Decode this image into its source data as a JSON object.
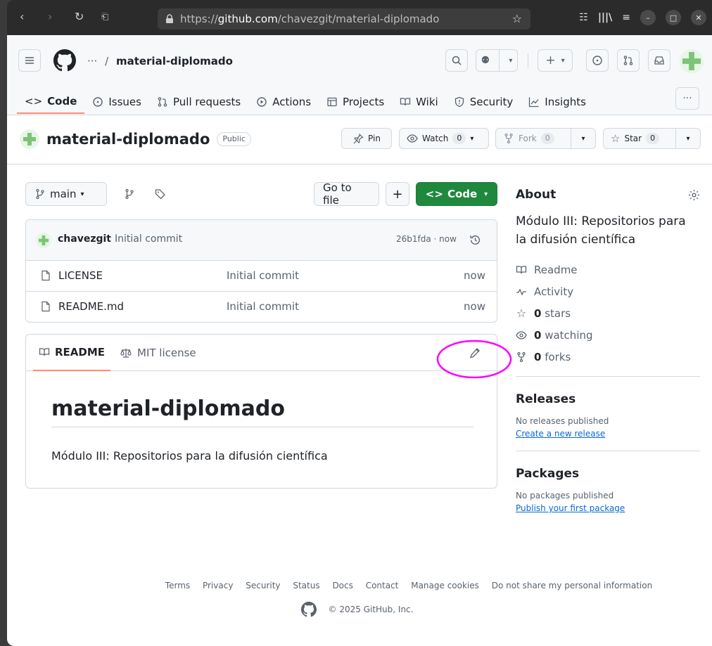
{
  "browser": {
    "url_prefix": "https://",
    "url_domain": "github.com",
    "url_path": "/chavezgit/material-diplomado"
  },
  "header": {
    "owner_ellipsis": "···",
    "separator": "/",
    "repo_name": "material-diplomado",
    "plus_label": "+",
    "more_label": "···"
  },
  "tabs": [
    {
      "label": "Code"
    },
    {
      "label": "Issues"
    },
    {
      "label": "Pull requests"
    },
    {
      "label": "Actions"
    },
    {
      "label": "Projects"
    },
    {
      "label": "Wiki"
    },
    {
      "label": "Security"
    },
    {
      "label": "Insights"
    }
  ],
  "repo": {
    "title": "material-diplomado",
    "visibility": "Public",
    "pin_label": "Pin",
    "watch_label": "Watch",
    "watch_count": "0",
    "fork_label": "Fork",
    "fork_count": "0",
    "star_label": "Star",
    "star_count": "0"
  },
  "toolbar": {
    "branch": "main",
    "go_to_file": "Go to file",
    "add": "+",
    "code": "Code"
  },
  "commit": {
    "author": "chavezgit",
    "message": "Initial commit",
    "hash_time": "26b1fda · now"
  },
  "files": [
    {
      "name": "LICENSE",
      "message": "Initial commit",
      "time": "now"
    },
    {
      "name": "README.md",
      "message": "Initial commit",
      "time": "now"
    }
  ],
  "readme": {
    "tab_readme": "README",
    "tab_license": "MIT license",
    "heading": "material-diplomado",
    "body": "Módulo III: Repositorios para la difusión científica"
  },
  "about": {
    "title": "About",
    "description": "Módulo III: Repositorios para la difusión científica",
    "readme": "Readme",
    "activity": "Activity",
    "stars_count": "0",
    "stars_label": "stars",
    "watching_count": "0",
    "watching_label": "watching",
    "forks_count": "0",
    "forks_label": "forks"
  },
  "releases": {
    "title": "Releases",
    "none": "No releases published",
    "create": "Create a new release"
  },
  "packages": {
    "title": "Packages",
    "none": "No packages published",
    "publish": "Publish your first package"
  },
  "footer": {
    "links": [
      "Terms",
      "Privacy",
      "Security",
      "Status",
      "Docs",
      "Contact",
      "Manage cookies",
      "Do not share my personal information"
    ],
    "copyright": "© 2025 GitHub, Inc."
  },
  "colors": {
    "accent_green": "#1f883d",
    "tab_underline": "#fd8c73",
    "annotation_circle": "#ff00ff"
  }
}
